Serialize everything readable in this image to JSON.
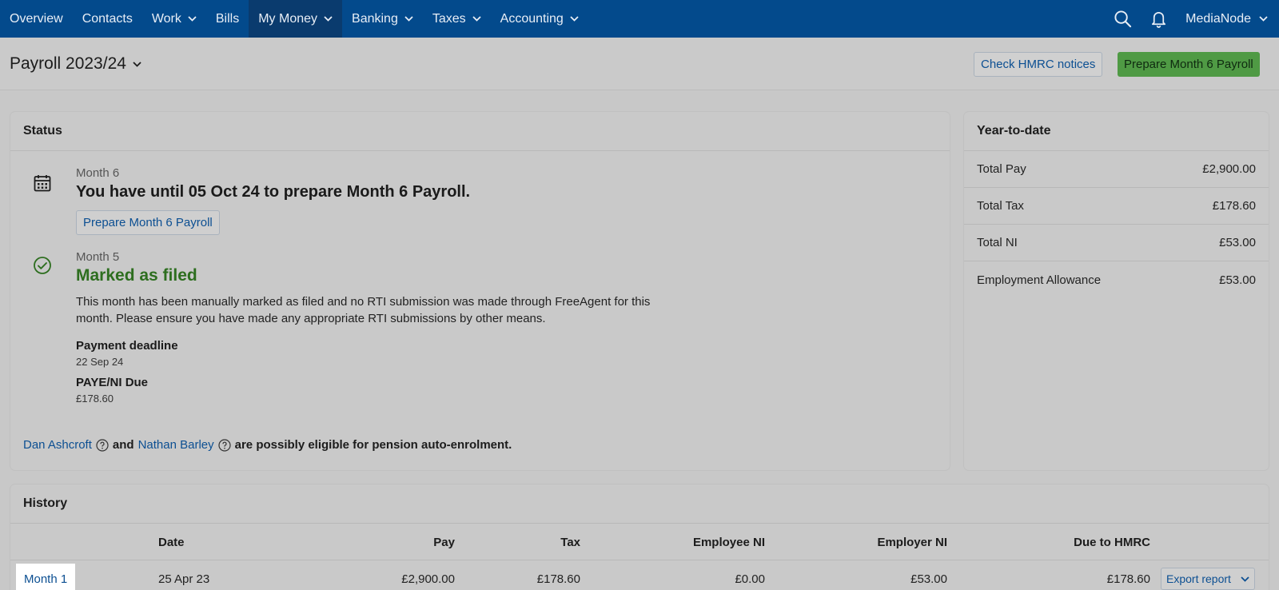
{
  "nav": {
    "items": [
      {
        "label": "Overview",
        "dropdown": false,
        "active": false
      },
      {
        "label": "Contacts",
        "dropdown": false,
        "active": false
      },
      {
        "label": "Work",
        "dropdown": true,
        "active": false
      },
      {
        "label": "Bills",
        "dropdown": false,
        "active": false
      },
      {
        "label": "My Money",
        "dropdown": true,
        "active": true
      },
      {
        "label": "Banking",
        "dropdown": true,
        "active": false
      },
      {
        "label": "Taxes",
        "dropdown": true,
        "active": false
      },
      {
        "label": "Accounting",
        "dropdown": true,
        "active": false
      }
    ],
    "account_name": "MediaNode"
  },
  "header": {
    "title": "Payroll 2023/24",
    "check_hmrc_label": "Check HMRC notices",
    "prepare_label": "Prepare Month 6 Payroll"
  },
  "status": {
    "heading": "Status",
    "current": {
      "month_label": "Month 6",
      "message": "You have until 05 Oct 24 to prepare Month 6 Payroll.",
      "button_label": "Prepare Month 6 Payroll"
    },
    "previous": {
      "month_label": "Month 5",
      "state": "Marked as filed",
      "description": "This month has been manually marked as filed and no RTI submission was made through FreeAgent for this month. Please ensure you have made any appropriate RTI submissions by other means.",
      "payment_deadline_label": "Payment deadline",
      "payment_deadline_value": "22 Sep 24",
      "paye_label": "PAYE/NI Due",
      "paye_value": "£178.60"
    },
    "pension": {
      "person1": "Dan Ashcroft",
      "and": "and",
      "person2": "Nathan Barley",
      "suffix": "are possibly eligible for pension auto-enrolment."
    }
  },
  "ytd": {
    "heading": "Year-to-date",
    "rows": [
      {
        "label": "Total Pay",
        "value": "£2,900.00"
      },
      {
        "label": "Total Tax",
        "value": "£178.60"
      },
      {
        "label": "Total NI",
        "value": "£53.00"
      },
      {
        "label": "Employment Allowance",
        "value": "£53.00"
      }
    ]
  },
  "history": {
    "heading": "History",
    "columns": {
      "date": "Date",
      "pay": "Pay",
      "tax": "Tax",
      "employee_ni": "Employee NI",
      "employer_ni": "Employer NI",
      "due": "Due to HMRC"
    },
    "rows": [
      {
        "month": "Month 1",
        "date": "25 Apr 23",
        "pay": "£2,900.00",
        "tax": "£178.60",
        "employee_ni": "£0.00",
        "employer_ni": "£53.00",
        "due": "£178.60",
        "export_label": "Export report"
      }
    ]
  },
  "colors": {
    "nav_bg": "#034a8c",
    "accent_blue": "#0c4f92",
    "success_green": "#2d6e1f",
    "primary_button": "#4f9a44"
  }
}
